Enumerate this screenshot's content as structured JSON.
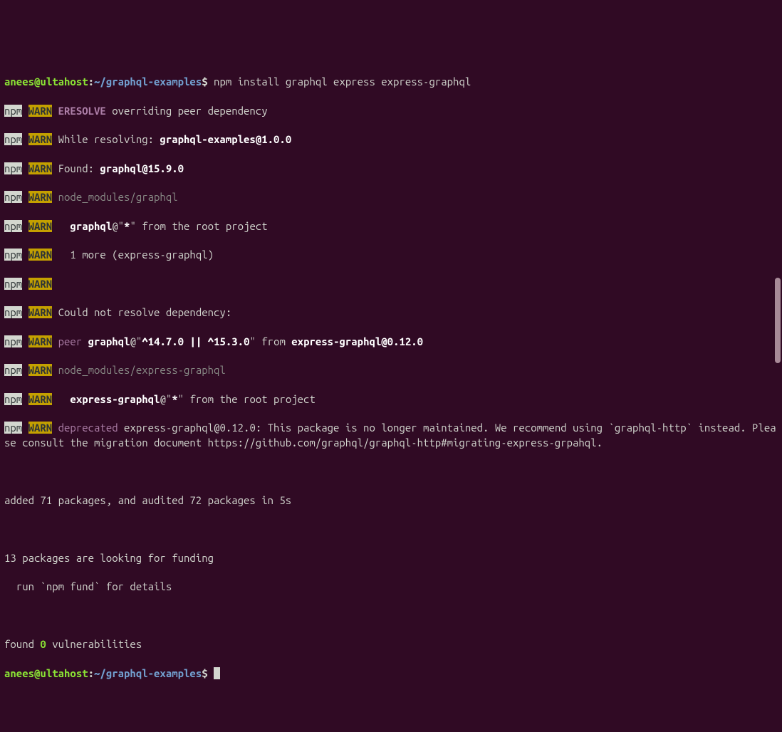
{
  "prompt1": {
    "user": "anees",
    "at": "@",
    "host": "ultahost",
    "colon": ":",
    "path": "~/graphql-examples",
    "dollar": "$",
    "command": " npm install graphql express express-graphql"
  },
  "npm": "npm",
  "warn": "WARN",
  "lines": [
    {
      "pre": " ",
      "eresolve": "ERESOLVE",
      "rest": " overriding peer dependency"
    },
    {
      "pre": " While resolving: ",
      "bold": "graphql-examples@1.0.0"
    },
    {
      "pre": " Found: ",
      "bold": "graphql@15.9.0"
    },
    {
      "dim": " node_modules/graphql"
    },
    {
      "pre": "   ",
      "bold": "graphql",
      "mid": "@\"",
      "bold2": "*",
      "rest": "\" from the root project"
    },
    {
      "pre": "   1 more (express-graphql)"
    },
    {
      "pre": ""
    },
    {
      "pre": " Could not resolve dependency:"
    },
    {
      "pre": " ",
      "peer": "peer",
      "mid": " ",
      "bold": "graphql",
      "mid2": "@\"",
      "bold2": "^14.7.0 || ^15.3.0",
      "mid3": "\" from ",
      "bold3": "express-graphql@0.12.0"
    },
    {
      "dim": " node_modules/express-graphql"
    },
    {
      "pre": "   ",
      "bold": "express-graphql",
      "mid": "@\"",
      "bold2": "*",
      "rest": "\" from the root project"
    }
  ],
  "deprecatedLine": {
    "deprecated": "deprecated",
    "rest": " express-graphql@0.12.0: This package is no longer maintained. We recommend using `graphql-http` instead. Please consult the migration document https://github.com/graphql/graphql-http#migrating-express-grpahql."
  },
  "summary": {
    "added": "added 71 packages, and audited 72 packages in 5s",
    "funding1": "13 packages are looking for funding",
    "funding2": "  run `npm fund` for details",
    "foundPre": "found ",
    "zero": "0",
    "foundPost": " vulnerabilities"
  },
  "prompt2": {
    "user": "anees",
    "at": "@",
    "host": "ultahost",
    "colon": ":",
    "path": "~/graphql-examples",
    "dollar": "$"
  }
}
